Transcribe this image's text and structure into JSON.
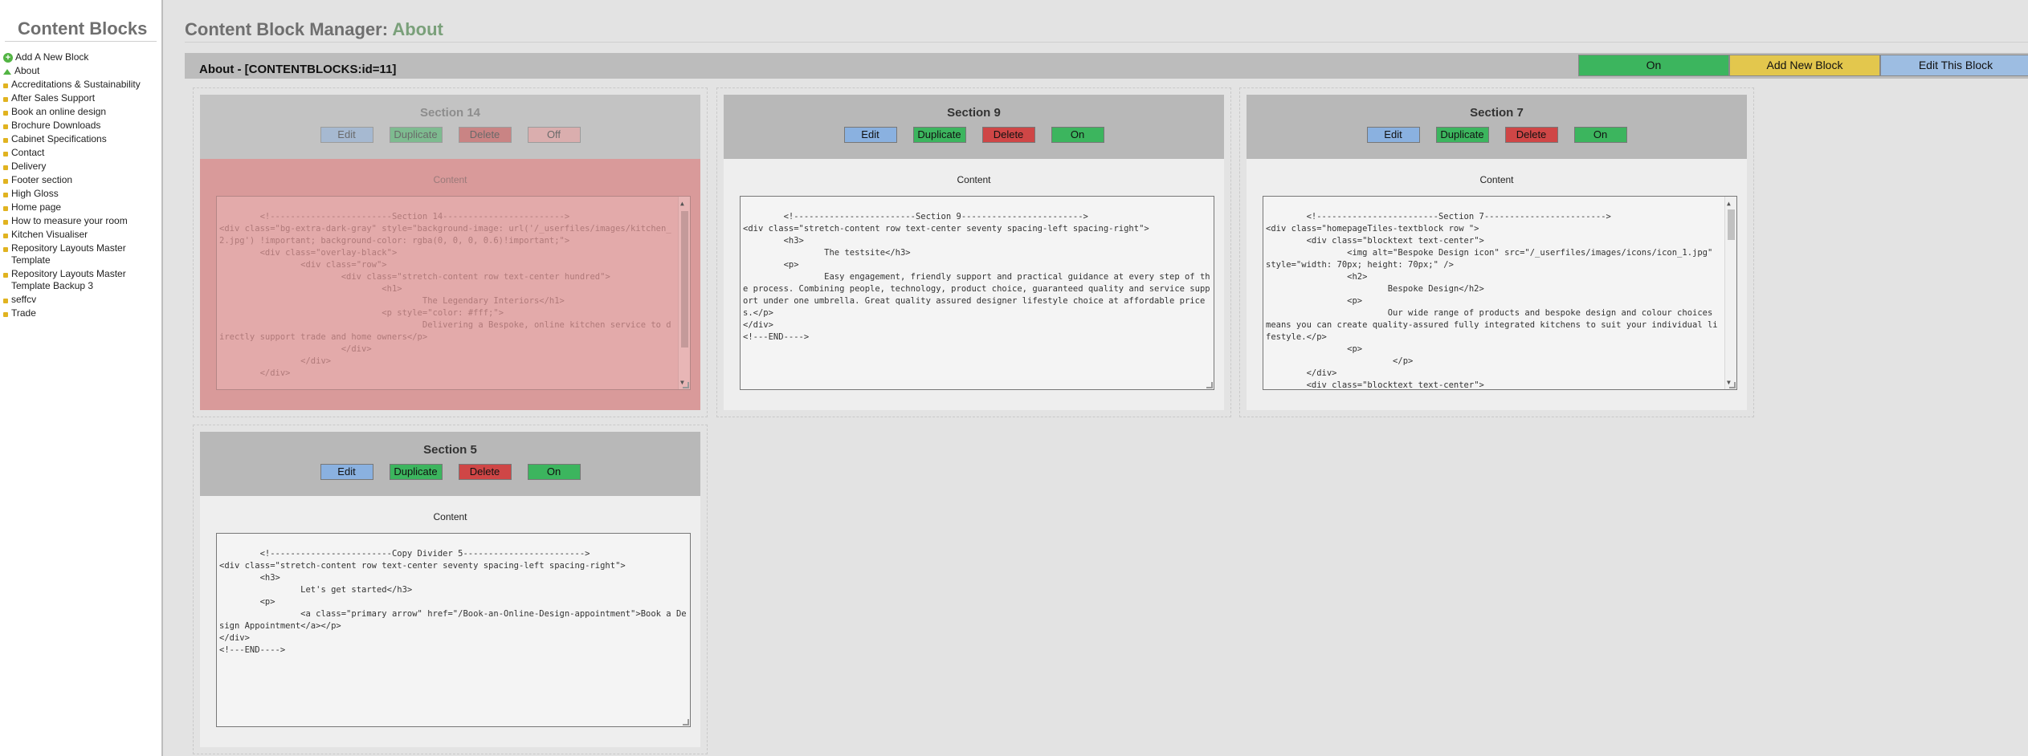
{
  "sidebar": {
    "title": "Content Blocks",
    "items": [
      {
        "label": "Add A New Block",
        "icon": "plus-circle-icon"
      },
      {
        "label": "About",
        "icon": "arrow-up-icon"
      },
      {
        "label": "Accreditations & Sustainability",
        "icon": "bullet-icon"
      },
      {
        "label": "After Sales Support",
        "icon": "bullet-icon"
      },
      {
        "label": "Book an online design",
        "icon": "bullet-icon"
      },
      {
        "label": "Brochure Downloads",
        "icon": "bullet-icon"
      },
      {
        "label": "Cabinet Specifications",
        "icon": "bullet-icon"
      },
      {
        "label": "Contact",
        "icon": "bullet-icon"
      },
      {
        "label": "Delivery",
        "icon": "bullet-icon"
      },
      {
        "label": "Footer section",
        "icon": "bullet-icon"
      },
      {
        "label": "High Gloss",
        "icon": "bullet-icon"
      },
      {
        "label": "Home page",
        "icon": "bullet-icon"
      },
      {
        "label": "How to measure your room",
        "icon": "bullet-icon"
      },
      {
        "label": "Kitchen Visualiser",
        "icon": "bullet-icon"
      },
      {
        "label": "Repository Layouts Master Template",
        "icon": "bullet-icon"
      },
      {
        "label": "Repository Layouts Master Template Backup 3",
        "icon": "bullet-icon"
      },
      {
        "label": "seffcv",
        "icon": "bullet-icon"
      },
      {
        "label": "Trade",
        "icon": "bullet-icon"
      }
    ]
  },
  "header": {
    "title_prefix": "Content Block Manager:",
    "title_accent": "About"
  },
  "block_bar": {
    "title": "About - [CONTENTBLOCKS:id=11]",
    "on_label": "On",
    "add_label": "Add New Block",
    "edit_label": "Edit This Block"
  },
  "colors": {
    "green": "#3cb55e",
    "yellow": "#e3c74d",
    "blue": "#9dbde2",
    "red": "#cf4646",
    "disabled_pink": "#d99a9a"
  },
  "sections": [
    {
      "title": "Section 14",
      "edit": "Edit",
      "duplicate": "Duplicate",
      "delete": "Delete",
      "toggle": "Off",
      "disabled": true,
      "content_label": "Content",
      "code": "<!------------------------Section 14------------------------>\n<div class=\"bg-extra-dark-gray\" style=\"background-image: url('/_userfiles/images/kitchen_2.jpg') !important; background-color: rgba(0, 0, 0, 0.6)!important;\">\n        <div class=\"overlay-black\">\n                <div class=\"row\">\n                        <div class=\"stretch-content row text-center hundred\">\n                                <h1>\n                                        The Legendary Interiors</h1>\n                                <p style=\"color: #fff;\">\n                                        Delivering a Bespoke, online kitchen service to directly support trade and home owners</p>\n                        </div>\n                </div>\n        </div>"
    },
    {
      "title": "Section 9",
      "edit": "Edit",
      "duplicate": "Duplicate",
      "delete": "Delete",
      "toggle": "On",
      "disabled": false,
      "content_label": "Content",
      "code": "<!------------------------Section 9------------------------>\n<div class=\"stretch-content row text-center seventy spacing-left spacing-right\">\n        <h3>\n                The testsite</h3>\n        <p>\n                Easy engagement, friendly support and practical guidance at every step of the process. Combining people, technology, product choice, guaranteed quality and service support under one umbrella. Great quality assured designer lifestyle choice at affordable prices.</p>\n</div>\n<!---END---->"
    },
    {
      "title": "Section 7",
      "edit": "Edit",
      "duplicate": "Duplicate",
      "delete": "Delete",
      "toggle": "On",
      "disabled": false,
      "content_label": "Content",
      "code": "<!------------------------Section 7------------------------>\n<div class=\"homepageTiles-textblock row \">\n        <div class=\"blocktext text-center\">\n                <img alt=\"Bespoke Design icon\" src=\"/_userfiles/images/icons/icon_1.jpg\" style=\"width: 70px; height: 70px;\" />\n                <h2>\n                        Bespoke Design</h2>\n                <p>\n                        Our wide range of products and bespoke design and colour choices means you can create quality-assured fully integrated kitchens to suit your individual lifestyle.</p>\n                <p>\n                         </p>\n        </div>\n        <div class=\"blocktext text-center\">"
    },
    {
      "title": "Section 5",
      "edit": "Edit",
      "duplicate": "Duplicate",
      "delete": "Delete",
      "toggle": "On",
      "disabled": false,
      "content_label": "Content",
      "code": "<!------------------------Copy Divider 5------------------------>\n<div class=\"stretch-content row text-center seventy spacing-left spacing-right\">\n        <h3>\n                Let's get started</h3>\n        <p>\n                <a class=\"primary arrow\" href=\"/Book-an-Online-Design-appointment\">Book a Design Appointment</a></p>\n</div>\n<!---END---->"
    }
  ]
}
